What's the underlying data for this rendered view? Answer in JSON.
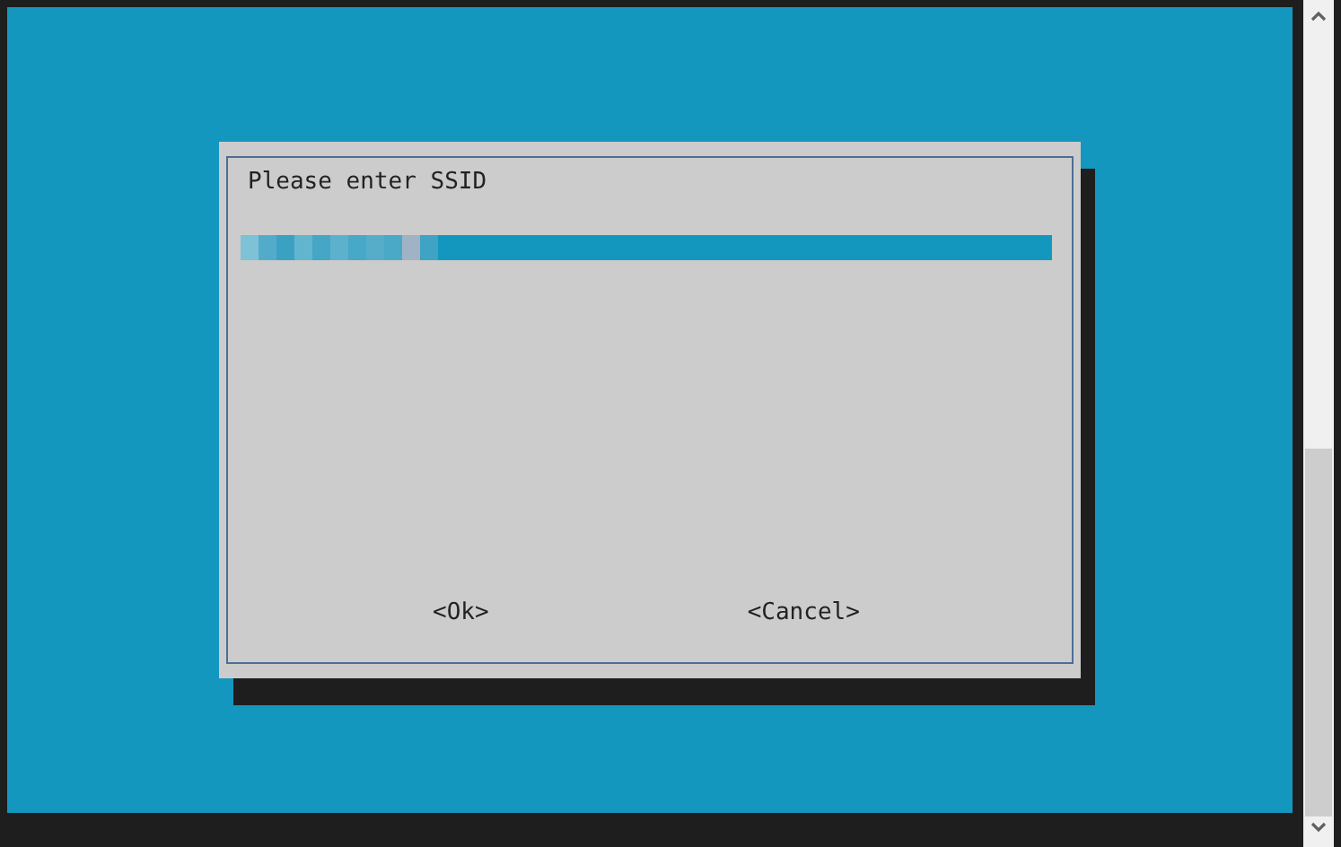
{
  "dialog": {
    "prompt": "Please enter SSID",
    "input": {
      "obscured": true
    },
    "buttons": [
      {
        "label": "<Ok>"
      },
      {
        "label": "<Cancel>"
      }
    ]
  }
}
